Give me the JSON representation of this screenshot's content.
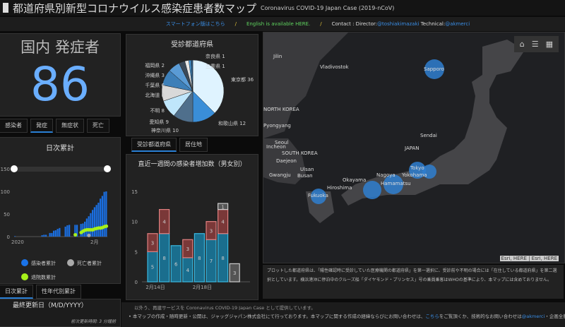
{
  "header": {
    "title": "都道府県別新型コロナウイルス感染症患者数マップ",
    "subtitle": "Coronavirus COVID-19 Japan Case (2019-nCoV)"
  },
  "links": {
    "smartphone": "スマートフォン版はこちら",
    "sep": "/",
    "english": "English is available HERE.",
    "contact_prefix": "Contact : Director:",
    "director": "@toshiakimazaki",
    "technical_prefix": " Technical:",
    "technical": "@akmerci"
  },
  "counter": {
    "title": "国内 発症者",
    "value": "86",
    "tabs": [
      "感染者",
      "発症",
      "無症状",
      "死亡"
    ],
    "active_tab": 1
  },
  "daily": {
    "title": "日次累計",
    "tabs": [
      "日次累計",
      "性年代別累計"
    ],
    "active_tab": 0,
    "legend": [
      {
        "label": "感染者累計",
        "color": "#1a73e8"
      },
      {
        "label": "死亡者累計",
        "color": "#aaaaaa"
      },
      {
        "label": "退院数累計",
        "color": "#a6f01a"
      }
    ]
  },
  "last_update": {
    "title": "最終更新日（M/D/YYYY）",
    "refresh": "前次更新時間: 3 分鐘前"
  },
  "pie": {
    "title": "受診都道府県",
    "tabs": [
      "受診都道府県",
      "居住地"
    ],
    "active_tab": 0
  },
  "stack": {
    "title": "直近一週間の感染者増加数（男女別）"
  },
  "map": {
    "labels": [
      "Jilin",
      "Vladivostok",
      "NORTH KOREA",
      "Pyongyang",
      "Seoul",
      "Incheon",
      "SOUTH KOREA",
      "Daejeon",
      "Gwangju",
      "Ulsan",
      "Busan",
      "Fukuoka",
      "Hiroshima",
      "Okayama",
      "Nagoya",
      "Hamamatsu",
      "Yokohama",
      "Tokyo",
      "Sendai",
      "JAPAN",
      "Sapporo"
    ],
    "attribution": "Esri, HERE | Esri, HERE",
    "tools": [
      "home-icon",
      "legend-list-icon",
      "basemap-gallery-icon"
    ]
  },
  "note": "プロットした都道府県は、「陽性確認時に受診していた医療機関の都道府県」を第一選択に、受診前や不明の場合には「在住している都道府県」を第二選択としています。横浜港沖に停泊中のクルーズ船「ダイヤモンド・プリンセス」号の乗員乗客はWHOの基準により、本マップには含めておりません。",
  "bottom": {
    "line1": "以外う、再建サービスを Coronavirus COVID-19 Japan Case として提供しています。",
    "line2_a": "本マップの作成・随時更新・公開は、ジャッグジャパン株式会社にて行っております。本マップに関する作成の経緯ならびにお問い合わせは、",
    "line2_link": "こちら",
    "line2_b": "をご覧頂くか、技術的なお問い合わせは",
    "line2_link2": "@akmerci",
    "line2_c": "・企画全般"
  },
  "chart_data": [
    {
      "type": "pie",
      "title": "受診都道府県",
      "slices": [
        {
          "label": "東京都",
          "value": 36,
          "color": "#dff3ff"
        },
        {
          "label": "和歌山県",
          "value": 12,
          "color": "#3a8ed8"
        },
        {
          "label": "神奈川県",
          "value": 10,
          "color": "#4f6f8c"
        },
        {
          "label": "愛知県",
          "value": 9,
          "color": "#bfe6fb"
        },
        {
          "label": "不明",
          "value": 8,
          "color": "#d9d9d9"
        },
        {
          "label": "北海道",
          "value": 8,
          "color": "#3d7fb8"
        },
        {
          "label": "千葉県",
          "value": 6,
          "color": "#5a9bd5"
        },
        {
          "label": "沖縄県",
          "value": 3,
          "color": "#3b4a5a"
        },
        {
          "label": "福岡県",
          "value": 2,
          "color": "#e8e8e8"
        },
        {
          "label": "三重県",
          "value": 1,
          "color": "#4aa3e8"
        },
        {
          "label": "奈良県",
          "value": 1,
          "color": "#2e5f8a"
        }
      ]
    },
    {
      "type": "bar",
      "stacked": true,
      "title": "直近一週間の感染者増加数（男女別）",
      "ylim": [
        0,
        15
      ],
      "yticks": [
        0,
        5,
        10,
        15
      ],
      "categories": [
        "2月14日",
        "",
        "",
        "",
        "2月18日",
        "",
        "",
        ""
      ],
      "series": [
        {
          "values": [
            5,
            8,
            6,
            4,
            8,
            7,
            8,
            0
          ],
          "color": "#1a6e8e"
        },
        {
          "values": [
            3,
            4,
            0,
            3,
            0,
            3,
            4,
            0
          ],
          "color": "#7a3838"
        },
        {
          "values": [
            0,
            0,
            0,
            0,
            0,
            0,
            1,
            3
          ],
          "color": "#555555"
        }
      ]
    },
    {
      "type": "bar",
      "title": "日次累計",
      "ylim": [
        0,
        150
      ],
      "yticks": [
        0,
        50,
        100,
        150
      ],
      "xticks": [
        "2020",
        "2月"
      ],
      "series": [
        {
          "name": "感染者累計",
          "values": [
            1,
            0,
            0,
            0,
            0,
            0,
            0,
            0,
            0,
            0,
            0,
            0,
            0,
            0,
            3,
            4,
            4,
            0,
            8,
            8,
            13,
            14,
            17,
            19,
            0,
            0,
            22,
            25,
            26,
            0,
            0,
            26,
            26,
            0,
            28,
            29,
            33,
            40,
            45,
            52,
            59,
            65,
            70,
            75,
            84,
            90,
            99,
            100
          ]
        },
        {
          "name": "退院数累計",
          "values": [
            0,
            0,
            0,
            0,
            0,
            0,
            0,
            0,
            0,
            0,
            0,
            0,
            0,
            0,
            0,
            0,
            0,
            0,
            0,
            0,
            0,
            0,
            0,
            0,
            0,
            0,
            0,
            0,
            0,
            0,
            0,
            4,
            0,
            0,
            9,
            12,
            14,
            15,
            15,
            15,
            15,
            17,
            18,
            19,
            19,
            20,
            22,
            23
          ]
        },
        {
          "name": "死亡者累計",
          "values": [
            0,
            0,
            0,
            0,
            0,
            0,
            0,
            0,
            0,
            0,
            0,
            0,
            0,
            0,
            0,
            0,
            0,
            0,
            0,
            0,
            0,
            0,
            0,
            0,
            0,
            0,
            0,
            0,
            0,
            0,
            0,
            0,
            0,
            0,
            0,
            0,
            0,
            0,
            1,
            1,
            1,
            1,
            1,
            1,
            1,
            1,
            1,
            1
          ]
        }
      ]
    }
  ]
}
